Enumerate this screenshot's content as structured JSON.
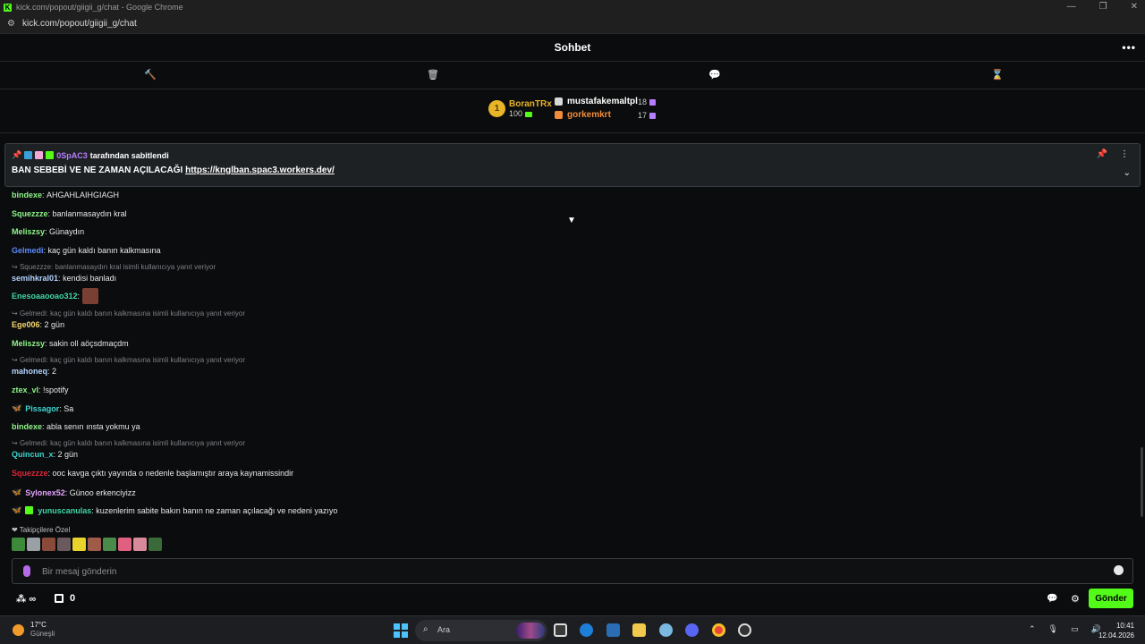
{
  "browser": {
    "title": "kick.com/popout/giigii_g/chat - Google Chrome",
    "url": "kick.com/popout/giigii_g/chat"
  },
  "header": {
    "title": "Sohbet"
  },
  "leaderboard": {
    "first": {
      "rank": "1",
      "name": "BoranTRx",
      "count": "100"
    },
    "rows": [
      {
        "name": "mustafakemaltpl",
        "count": "18"
      },
      {
        "name": "gorkemkrt",
        "count": "17"
      }
    ]
  },
  "pinned": {
    "pinned_by_user": "0SpAC3",
    "pinned_by_text": "tarafından sabitlendi",
    "message_prefix": "BAN SEBEBİ VE NE ZAMAN AÇILACAĞI",
    "link": "https://knglban.spac3.workers.dev/"
  },
  "messages": [
    {
      "user": "bindexe",
      "color": "#8ef58a",
      "text": "AHGAHLAIHGIAGH"
    },
    {
      "user": "Squezzze",
      "color": "#8ef58a",
      "text": "banlanmasaydın kral"
    },
    {
      "user": "Meliszsy",
      "color": "#8ef58a",
      "text": "Günaydın"
    },
    {
      "user": "Gelmedi",
      "color": "#5b8cff",
      "text": "kaç gün kaldı banın kalkmasına"
    },
    {
      "reply": "Squezzze: banlanmasaydın kral isimli kullanıcıya yanıt veriyor",
      "user": "semihkral01",
      "color": "#b3d4ff",
      "text": "kendisi banladı"
    },
    {
      "user": "Enesoaaooao312",
      "color": "#3fd6a8",
      "text": ""
    },
    {
      "reply": "Gelmedi: kaç gün kaldı banın kalkmasına isimli kullanıcıya yanıt veriyor",
      "user": "Ege006",
      "color": "#f5d76e",
      "text": "2 gün"
    },
    {
      "user": "Meliszsy",
      "color": "#8ef58a",
      "text": "sakin oll aöçsdmaçdm"
    },
    {
      "reply": "Gelmedi: kaç gün kaldı banın kalkmasına isimli kullanıcıya yanıt veriyor",
      "user": "mahoneq",
      "color": "#b3d4ff",
      "text": "2"
    },
    {
      "user": "ztex_vl",
      "color": "#8ef58a",
      "text": "!spotify"
    },
    {
      "user": "Pissagor",
      "color": "#3fd6d0",
      "text": "Sa"
    },
    {
      "user": "bindexe",
      "color": "#8ef58a",
      "text": "abla senın ınsta yokmu ya"
    },
    {
      "reply": "Gelmedi: kaç gün kaldı banın kalkmasına isimli kullanıcıya yanıt veriyor",
      "user": "Quincun_x",
      "color": "#3fd6d0",
      "text": "2 gün"
    },
    {
      "user": "Squezzze",
      "color": "#e0263a",
      "text": "ooc kavga çıktı yayında o nedenle başlamıştır araya kaynamissindir"
    },
    {
      "user": "Sylonex52",
      "color": "#e3a3ff",
      "text": "Günoo erkenciyizz"
    },
    {
      "user": "yunuscanulas",
      "color": "#3fd6a8",
      "text": "kuzenlerim sabite bakın banın ne zaman açılacağı ve nedeni yazıyo"
    }
  ],
  "emote_section": {
    "label": "Takipçilere Özel"
  },
  "composer": {
    "placeholder": "Bir mesaj gönderin",
    "send_label": "Gönder"
  },
  "bottombar": {
    "infinity": "∞",
    "points": "0"
  },
  "taskbar": {
    "temp": "17°C",
    "weather": "Güneşli",
    "search_placeholder": "Ara",
    "time": "10:41",
    "date": "12.04.2026"
  }
}
